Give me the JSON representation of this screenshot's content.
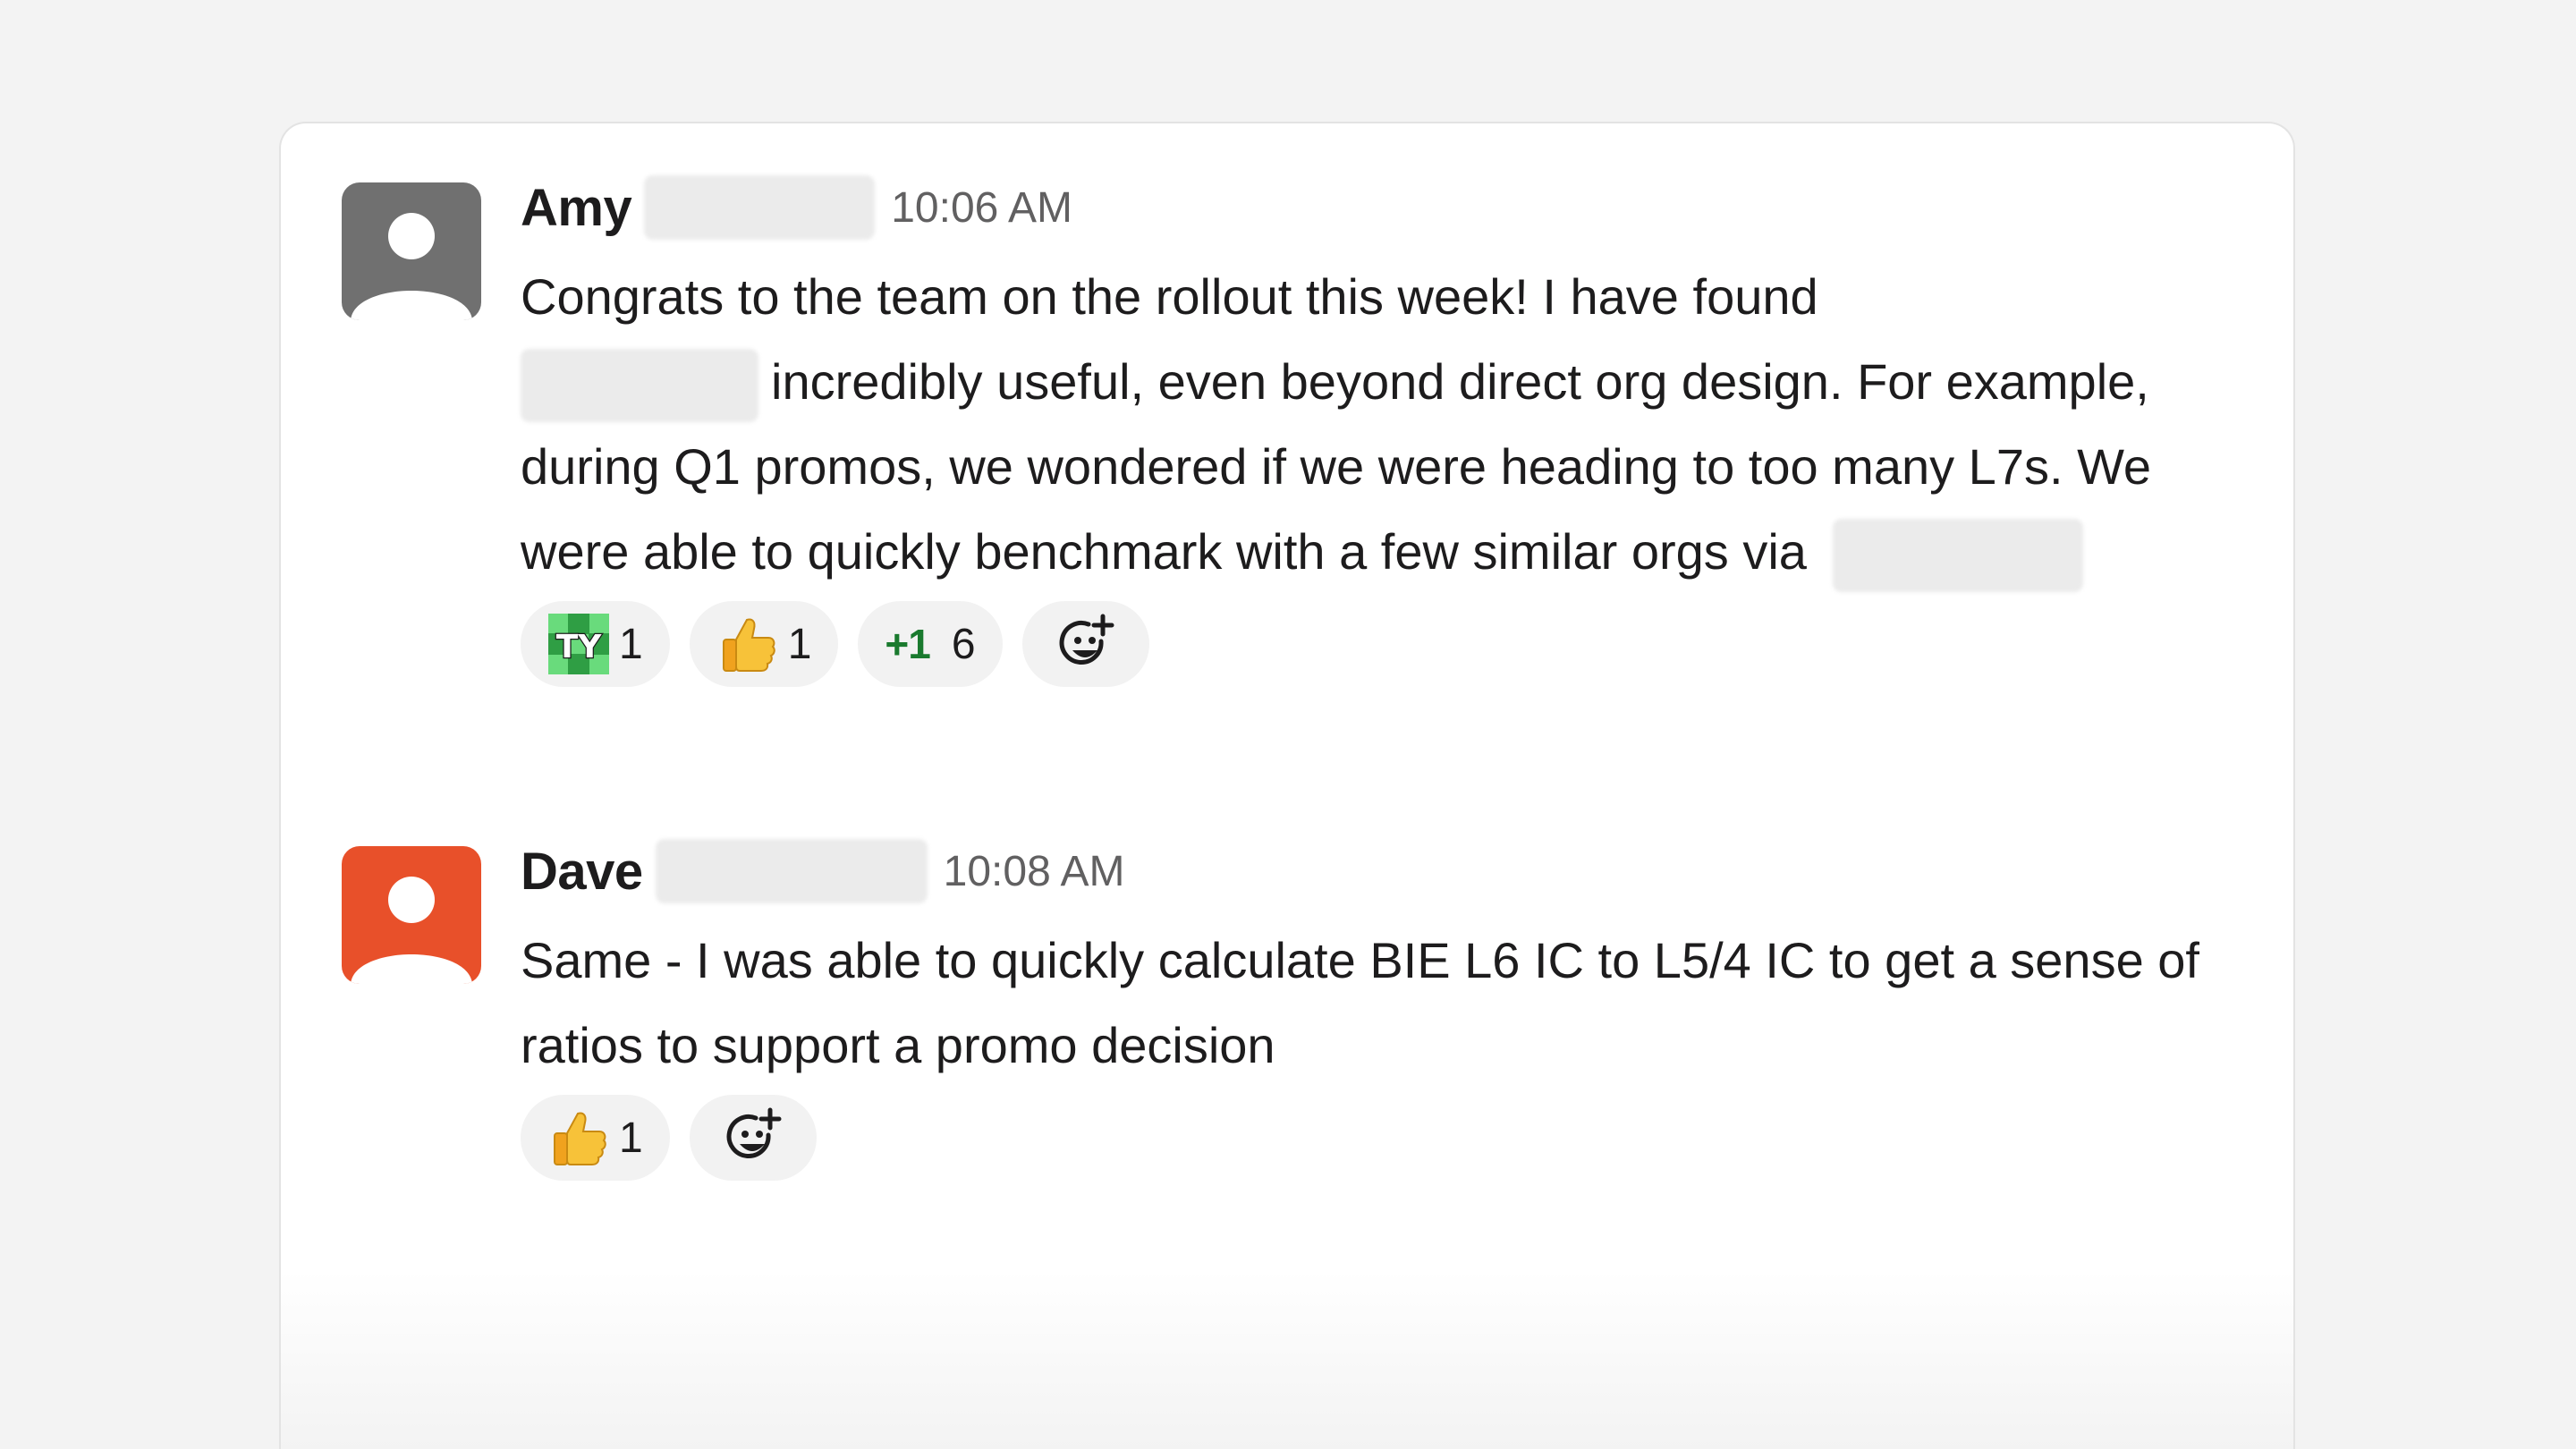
{
  "messages": [
    {
      "author": "Amy",
      "time": "10:06 AM",
      "avatar_color": "#707070",
      "text_part1": "Congrats to the team on the rollout this week! I have found",
      "text_part2": "incredibly useful, even beyond direct org design. For example, during Q1 promos, we wondered if we were heading to too many L7s. We were able to quickly benchmark with a few similar orgs via",
      "reactions": [
        {
          "emoji": "ty-icon",
          "count": "1"
        },
        {
          "emoji": "thumbs-up-icon",
          "count": "1"
        },
        {
          "emoji": "plus-one-icon",
          "label": "+1",
          "count": "6"
        }
      ]
    },
    {
      "author": "Dave",
      "time": "10:08 AM",
      "avatar_color": "#e8502a",
      "text": "Same - I was able to quickly calculate BIE L6 IC to L5/4 IC to get a sense of ratios to support a promo decision",
      "reactions": [
        {
          "emoji": "thumbs-up-icon",
          "count": "1"
        }
      ]
    }
  ],
  "colors": {
    "background": "#f3f3f3",
    "card": "#ffffff",
    "reaction_pill": "#f2f2f2",
    "timestamp": "#616061",
    "plus_one_green": "#1a7a2e"
  }
}
